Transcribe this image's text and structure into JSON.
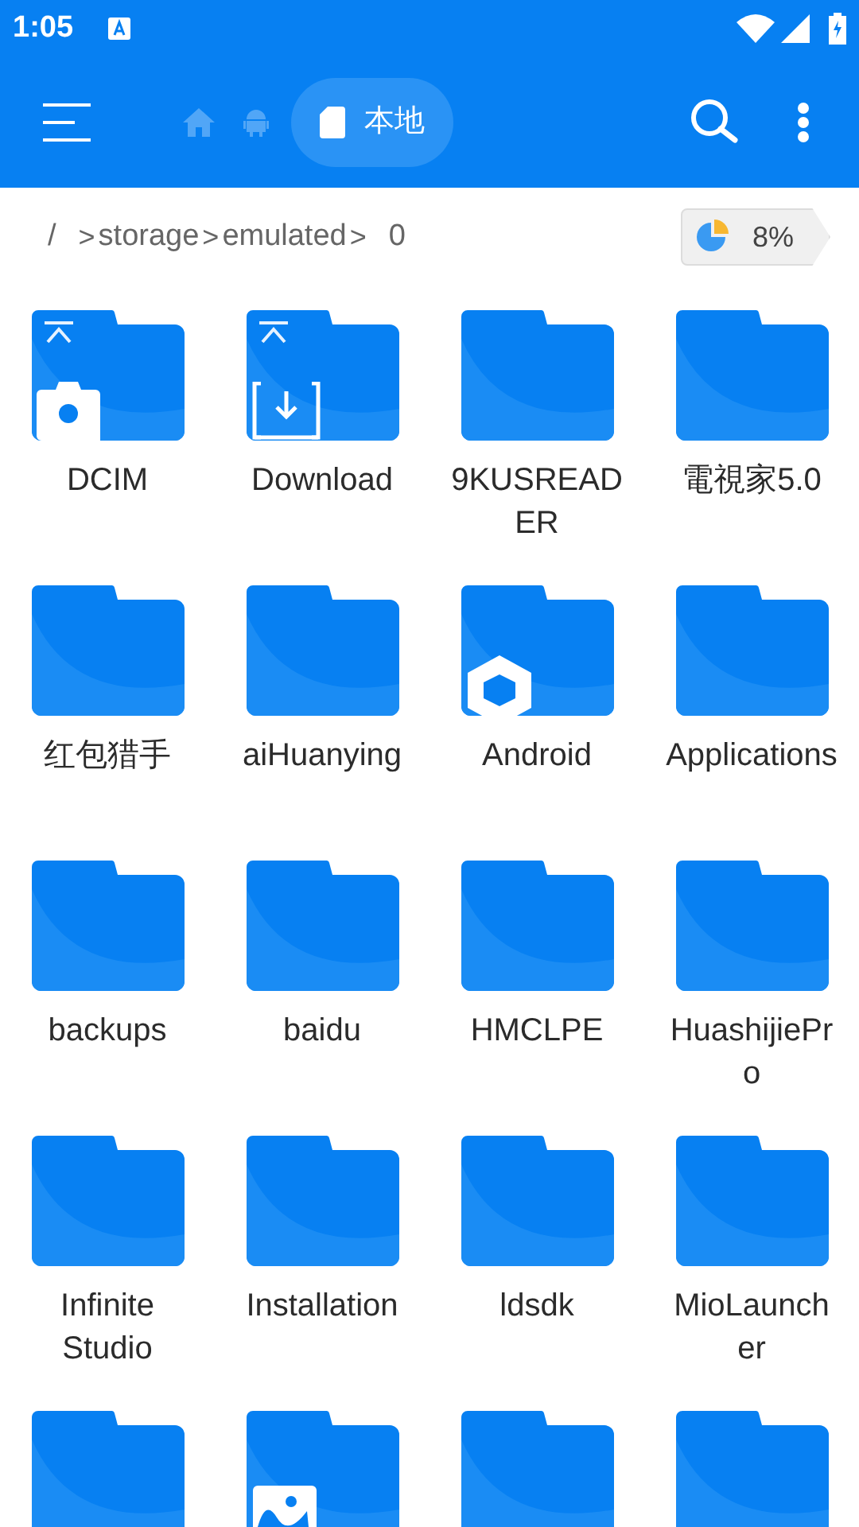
{
  "status_bar": {
    "time": "1:05"
  },
  "toolbar": {
    "nav_tabs": [
      {
        "kind": "home",
        "selected": false
      },
      {
        "kind": "android",
        "selected": false
      },
      {
        "kind": "local",
        "label": "本地",
        "selected": true
      }
    ]
  },
  "path_bar": {
    "separator": ">",
    "crumbs": [
      "/",
      "storage",
      "emulated",
      "0"
    ],
    "storage_usage": "8%"
  },
  "folders": [
    {
      "name": "DCIM",
      "kind": "camera",
      "pinned": true
    },
    {
      "name": "Download",
      "kind": "download",
      "pinned": true
    },
    {
      "name": "9KUSREADER",
      "kind": "plain",
      "pinned": false
    },
    {
      "name": "電視家5.0",
      "kind": "plain",
      "pinned": false
    },
    {
      "name": "红包猎手",
      "kind": "plain",
      "pinned": false
    },
    {
      "name": "aiHuanying",
      "kind": "plain",
      "pinned": false
    },
    {
      "name": "Android",
      "kind": "android",
      "pinned": false
    },
    {
      "name": "Applications",
      "kind": "plain",
      "pinned": false
    },
    {
      "name": "backups",
      "kind": "plain",
      "pinned": false
    },
    {
      "name": "baidu",
      "kind": "plain",
      "pinned": false
    },
    {
      "name": "HMCLPE",
      "kind": "plain",
      "pinned": false
    },
    {
      "name": "HuashijiePro",
      "kind": "plain",
      "pinned": false
    },
    {
      "name": "Infinite Studio",
      "kind": "plain",
      "pinned": false
    },
    {
      "name": "Installation",
      "kind": "plain",
      "pinned": false
    },
    {
      "name": "ldsdk",
      "kind": "plain",
      "pinned": false
    },
    {
      "name": "MioLauncher",
      "kind": "plain",
      "pinned": false
    },
    {
      "kind": "plain",
      "pinned": false
    },
    {
      "kind": "image",
      "pinned": false
    },
    {
      "kind": "plain",
      "pinned": false
    },
    {
      "kind": "plain",
      "pinned": false
    }
  ]
}
